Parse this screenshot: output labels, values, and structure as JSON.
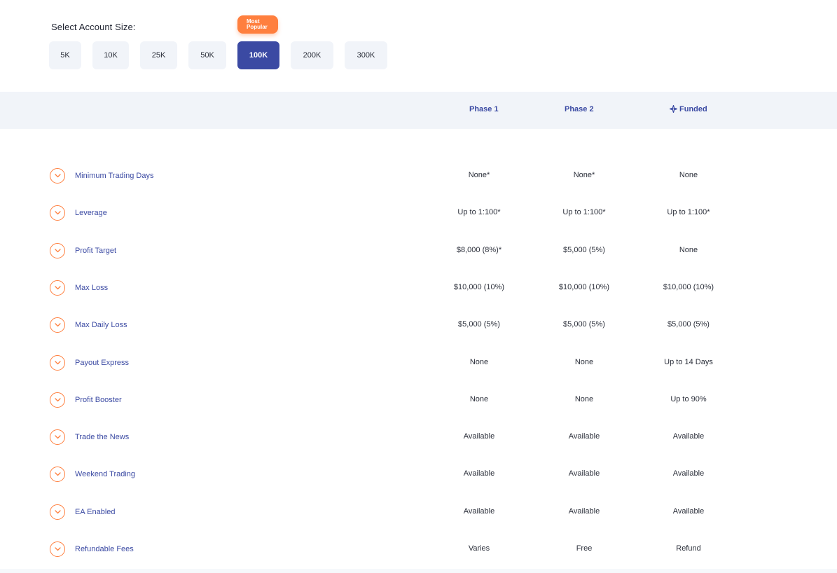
{
  "selector": {
    "label": "Select Account Size:",
    "badge_line1": "Most",
    "badge_line2": "Popular",
    "sizes": [
      "5K",
      "10K",
      "25K",
      "50K",
      "100K",
      "200K",
      "300K"
    ],
    "selected": "100K"
  },
  "columns": {
    "phase1": "Phase 1",
    "phase2": "Phase 2",
    "funded": "Funded"
  },
  "rows": [
    {
      "label": "Minimum Trading Days",
      "phase1": "None*",
      "phase2": "None*",
      "funded": "None"
    },
    {
      "label": "Leverage",
      "phase1": "Up to 1:100*",
      "phase2": "Up to 1:100*",
      "funded": "Up to 1:100*"
    },
    {
      "label": "Profit Target",
      "phase1": "$8,000 (8%)*",
      "phase2": "$5,000 (5%)",
      "funded": "None"
    },
    {
      "label": "Max Loss",
      "phase1": "$10,000 (10%)",
      "phase2": "$10,000 (10%)",
      "funded": "$10,000 (10%)"
    },
    {
      "label": "Max Daily Loss",
      "phase1": "$5,000 (5%)",
      "phase2": "$5,000 (5%)",
      "funded": "$5,000 (5%)"
    },
    {
      "label": "Payout Express",
      "phase1": "None",
      "phase2": "None",
      "funded": "Up to 14 Days"
    },
    {
      "label": "Profit Booster",
      "phase1": "None",
      "phase2": "None",
      "funded": "Up to 90%"
    },
    {
      "label": "Trade the News",
      "phase1": "Available",
      "phase2": "Available",
      "funded": "Available"
    },
    {
      "label": "Weekend Trading",
      "phase1": "Available",
      "phase2": "Available",
      "funded": "Available"
    },
    {
      "label": "EA Enabled",
      "phase1": "Available",
      "phase2": "Available",
      "funded": "Available"
    },
    {
      "label": "Refundable Fees",
      "phase1": "Varies",
      "phase2": "Free",
      "funded": "Refund"
    }
  ],
  "colors": {
    "accent": "#3b4aa3",
    "orange": "#ff7f3e",
    "band": "#f1f4f9"
  },
  "icons": {
    "row_toggle": "chevron-down-icon",
    "funded": "funded-icon"
  }
}
